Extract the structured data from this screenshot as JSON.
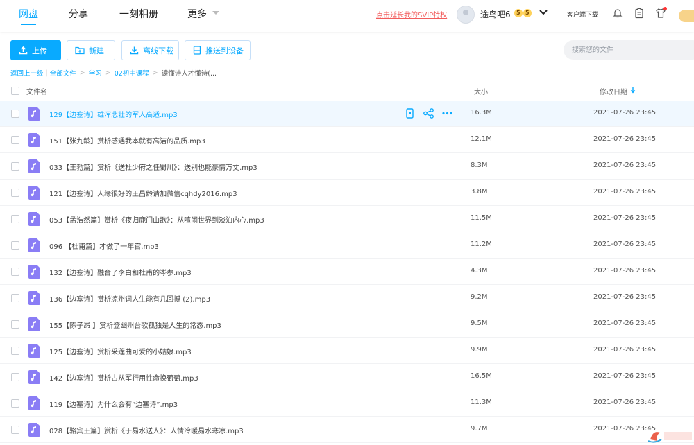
{
  "nav": {
    "items": [
      {
        "label": "网盘",
        "active": true
      },
      {
        "label": "分享",
        "active": false
      },
      {
        "label": "一刻相册",
        "active": false
      },
      {
        "label": "更多",
        "active": false
      }
    ],
    "svip_link": "点击延长我的SVIP特权",
    "username": "途鸟吧6",
    "badges": [
      "5",
      "5"
    ],
    "client_download": "客户端下载",
    "icons": [
      "bell-icon",
      "clipboard-icon",
      "shirt-icon"
    ],
    "accent_color": "#09aaff"
  },
  "toolbar": {
    "upload": "上传",
    "new_folder": "新建",
    "offline_download": "离线下载",
    "push_device": "推送到设备",
    "search_placeholder": "搜索您的文件"
  },
  "breadcrumb": {
    "back": "返回上一级",
    "all_files": "全部文件",
    "items": [
      "学习",
      "02初中课程"
    ],
    "current": "读懂诗人才懂诗(..."
  },
  "table": {
    "headers": {
      "name": "文件名",
      "size": "大小",
      "date": "修改日期"
    },
    "sort": "date-desc",
    "rows": [
      {
        "name": "129【边塞诗】雄浑悲壮的军人高适.mp3",
        "size": "16.3M",
        "date": "2021-07-26 23:45",
        "hover": true
      },
      {
        "name": "151【张九龄】赏析感遇我本就有高洁的品质.mp3",
        "size": "12.1M",
        "date": "2021-07-26 23:45"
      },
      {
        "name": "033【王勃篇】赏析《送杜少府之任蜀川》：送别也能豪情万丈.mp3",
        "size": "8.3M",
        "date": "2021-07-26 23:45"
      },
      {
        "name": "121【边塞诗】人缘很好的王昌龄请加微信cqhdy2016.mp3",
        "size": "3.8M",
        "date": "2021-07-26 23:45"
      },
      {
        "name": "053【孟浩然篇】赏析《夜归鹿门山歌》：从喧闹世界到淡泊内心.mp3",
        "size": "11.5M",
        "date": "2021-07-26 23:45"
      },
      {
        "name": "096 【杜甫篇】才做了一年官.mp3",
        "size": "11.2M",
        "date": "2021-07-26 23:45"
      },
      {
        "name": "132【边塞诗】融合了李白和杜甫的岑参.mp3",
        "size": "4.3M",
        "date": "2021-07-26 23:45"
      },
      {
        "name": "136【边塞诗】赏析凉州词人生能有几回搏 (2).mp3",
        "size": "9.2M",
        "date": "2021-07-26 23:45"
      },
      {
        "name": "155【陈子昂 】赏析登幽州台歌孤独是人生的常态.mp3",
        "size": "9.5M",
        "date": "2021-07-26 23:45"
      },
      {
        "name": "125【边塞诗】赏析采莲曲可爱的小姑娘.mp3",
        "size": "9.9M",
        "date": "2021-07-26 23:45"
      },
      {
        "name": "142【边塞诗】赏析古从军行用性命换葡萄.mp3",
        "size": "16.5M",
        "date": "2021-07-26 23:45"
      },
      {
        "name": "119【边塞诗】为什么会有“边塞诗”.mp3",
        "size": "11.3M",
        "date": "2021-07-26 23:45"
      },
      {
        "name": "028【骆宾王篇】赏析《于易水送人》：人情冷暖易水寒凉.mp3",
        "size": "9.7M",
        "date": "2021-07-26 23:45"
      }
    ],
    "row_actions": [
      "phone-icon",
      "share-icon",
      "more-icon"
    ]
  }
}
